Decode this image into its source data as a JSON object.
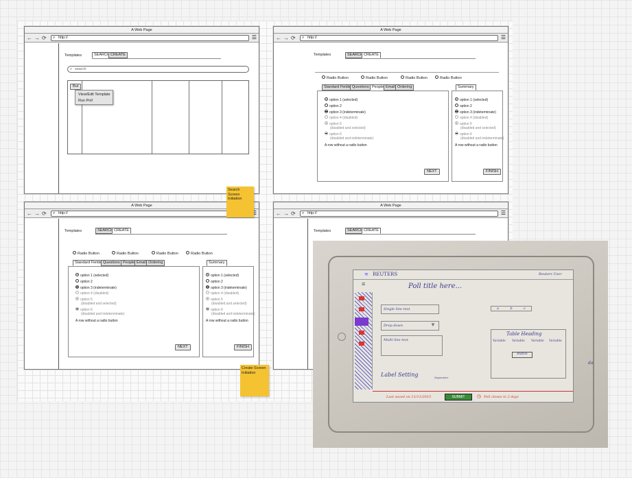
{
  "window_title": "A Web Page",
  "url": "http://",
  "nav": {
    "back": "←",
    "forward": "→",
    "refresh": "⟳",
    "menu": "☰",
    "search_glyph": "⌕"
  },
  "templates_label": "Templates",
  "search_tab": "SEARCH",
  "create_tab": "CREATE",
  "search_placeholder": "search",
  "context_menu": {
    "button": "But",
    "items": [
      "View/Edit Template",
      "Run Poll"
    ]
  },
  "radio_row": [
    "Radio Button",
    "Radio Button",
    "Radio Button",
    "Radio Button"
  ],
  "panel_tabs": [
    "Standard Fields",
    "Questions",
    "People",
    "Email",
    "Ordering"
  ],
  "summary_tab": "Summary",
  "options": [
    {
      "label": "option 1 (selected)",
      "state": "on"
    },
    {
      "label": "option 2",
      "state": "off"
    },
    {
      "label": "option 3 (indeterminate)",
      "state": "ind"
    },
    {
      "label": "option 4 (disabled)",
      "state": "dis"
    },
    {
      "label": "option 5",
      "sub": "(disabled and selected)",
      "state": "dis-on"
    },
    {
      "label": "option 6",
      "sub": "(disabled and indeterminate)",
      "state": "dis-ind"
    }
  ],
  "row_without_radio": "A row without a radio button",
  "next_label": "NEXT",
  "finish_label": "FINISH",
  "sticky1": "Search Screen\nInitiation",
  "sticky2": "Create Screen\nInitiation",
  "sketch": {
    "brand": "REUTERS",
    "title": "Poll title here...",
    "user": "Reuters User",
    "single_line": "Single line text",
    "dropdown": "Drop down",
    "multiline": "Multi-line text",
    "label_setting": "Label Setting",
    "table_heading": "Table Heading",
    "table_cols": [
      "Variable",
      "Variable",
      "Variable",
      "Variable"
    ],
    "button": "Button",
    "abc": [
      "a",
      "b",
      "c"
    ],
    "seperator": "Seperator",
    "last_saved": "Last saved on 11/11/2015",
    "submit": "SUBMIT",
    "poll_closes": "Poll closes in 2 days",
    "side_label": "da"
  }
}
